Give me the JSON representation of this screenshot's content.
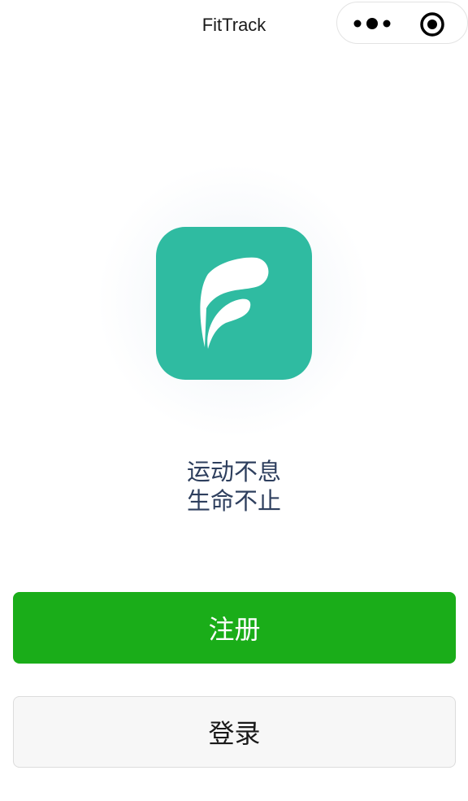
{
  "navbar": {
    "title": "FitTrack",
    "more_icon": "more-dots-icon",
    "close_icon": "target-close-icon"
  },
  "logo": {
    "icon": "fittrack-f-logo",
    "bg_color": "#2fbba1"
  },
  "slogan": {
    "line1": "运动不息",
    "line2": "生命不止"
  },
  "buttons": {
    "register_label": "注册",
    "login_label": "登录"
  },
  "colors": {
    "primary": "#1aad19",
    "brand": "#2fbba1",
    "slogan_text": "#2e3f5e"
  }
}
